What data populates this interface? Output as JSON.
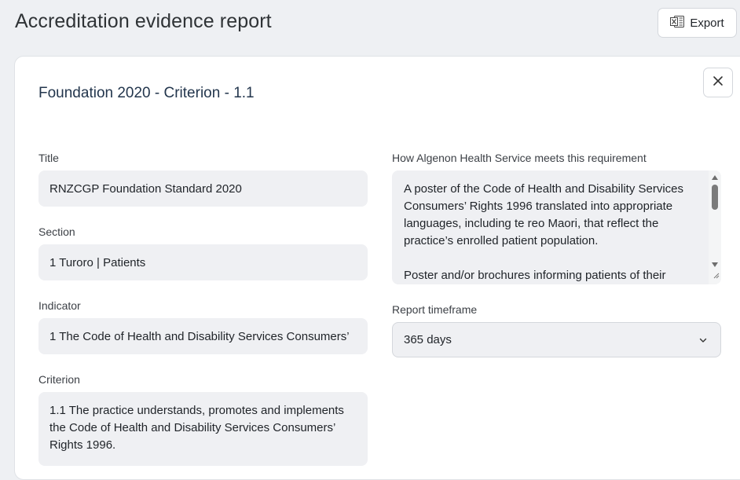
{
  "header": {
    "title": "Accreditation evidence report",
    "export_label": "Export"
  },
  "panel": {
    "heading": "Foundation 2020 - Criterion - 1.1"
  },
  "fields": {
    "title": {
      "label": "Title",
      "value": "RNZCGP Foundation Standard 2020"
    },
    "section": {
      "label": "Section",
      "value": "1 Turoro | Patients"
    },
    "indicator": {
      "label": "Indicator",
      "value": "1 The Code of Health and Disability Services Consumers’"
    },
    "criterion": {
      "label": "Criterion",
      "value": "1.1 The practice understands, promotes and implements the Code of Health and Disability Services Consumers’ Rights 1996."
    },
    "requirement": {
      "label": "How Algenon Health Service meets this requirement",
      "paragraph1": "A poster of the Code of Health and Disability Services Consumers’ Rights 1996 translated into appropriate languages, including te reo Maori, that reflect the practice’s enrolled patient population.",
      "paragraph2": "Poster and/or brochures informing patients of their"
    },
    "timeframe": {
      "label": "Report timeframe",
      "value": "365 days"
    }
  },
  "icons": {
    "export": "excel-icon",
    "close": "close-icon",
    "dropdown": "chevron-down-icon"
  },
  "colors": {
    "background": "#eef0f3",
    "panel": "#ffffff",
    "field": "#eff0f3",
    "heading": "#23364d"
  }
}
